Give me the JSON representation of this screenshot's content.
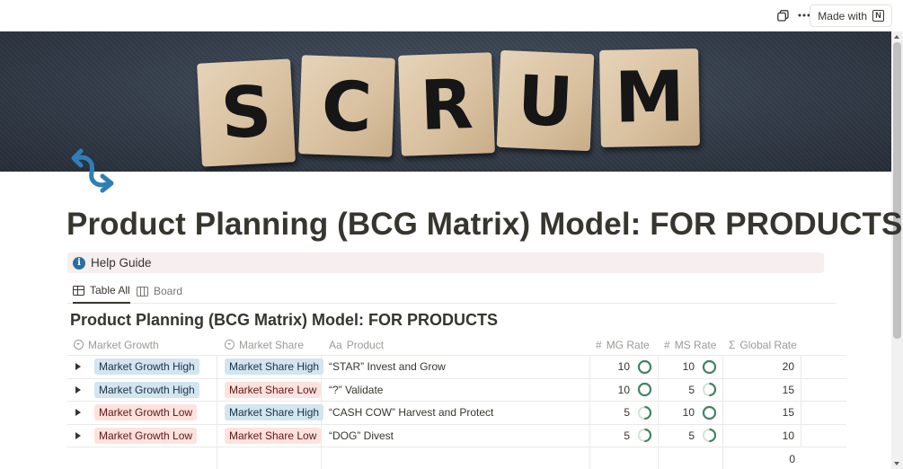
{
  "topbar": {
    "duplicate_icon": "duplicate-icon",
    "more_icon": "more-icon",
    "made_with_label": "Made with",
    "notion_logo_text": "N"
  },
  "cover": {
    "letters": [
      "S",
      "C",
      "R",
      "U",
      "M"
    ],
    "background_color": "#333c49",
    "tile_color": "#d8c09f"
  },
  "page": {
    "icon": "arrows-icon",
    "icon_color": "#2f7fb6",
    "title": "Product Planning (BCG Matrix) Model: FOR PRODUCTS"
  },
  "callout": {
    "icon": "info-icon",
    "text": "Help Guide"
  },
  "views": [
    {
      "label": "Table All",
      "icon": "table-icon",
      "active": true
    },
    {
      "label": "Board",
      "icon": "board-icon",
      "active": false
    }
  ],
  "database": {
    "title": "Product Planning (BCG Matrix) Model: FOR PRODUCTS",
    "columns": [
      {
        "label": "Market Growth",
        "type_icon": "select-icon"
      },
      {
        "label": "Market Share",
        "type_icon": "select-icon"
      },
      {
        "label": "Product",
        "type_icon": "Aa"
      },
      {
        "label": "MG Rate",
        "type_icon": "#"
      },
      {
        "label": "MS Rate",
        "type_icon": "#"
      },
      {
        "label": "Global Rate",
        "type_icon": "Σ"
      }
    ],
    "rows": [
      {
        "market_growth": "Market Growth High",
        "mg_color": "blue",
        "market_share": "Market Share High",
        "ms_color": "blue",
        "product": "“STAR” Invest and Grow",
        "mg_rate": "10",
        "mg_progress": 1.0,
        "ms_rate": "10",
        "ms_progress": 1.0,
        "global_rate": "20"
      },
      {
        "market_growth": "Market Growth High",
        "mg_color": "blue",
        "market_share": "Market Share Low",
        "ms_color": "red",
        "product": "“?” Validate",
        "mg_rate": "10",
        "mg_progress": 1.0,
        "ms_rate": "5",
        "ms_progress": 0.5,
        "global_rate": "15"
      },
      {
        "market_growth": "Market Growth Low",
        "mg_color": "red",
        "market_share": "Market Share High",
        "ms_color": "blue",
        "product": "“CASH COW” Harvest and Protect",
        "mg_rate": "5",
        "mg_progress": 0.5,
        "ms_rate": "10",
        "ms_progress": 1.0,
        "global_rate": "15"
      },
      {
        "market_growth": "Market Growth Low",
        "mg_color": "red",
        "market_share": "Market Share Low",
        "ms_color": "red",
        "product": "“DOG” Divest",
        "mg_rate": "5",
        "mg_progress": 0.5,
        "ms_rate": "5",
        "ms_progress": 0.5,
        "global_rate": "10"
      }
    ],
    "summary_global_rate": "0",
    "ring_color": "#448361",
    "ring_track_color": "#d4e5da"
  }
}
